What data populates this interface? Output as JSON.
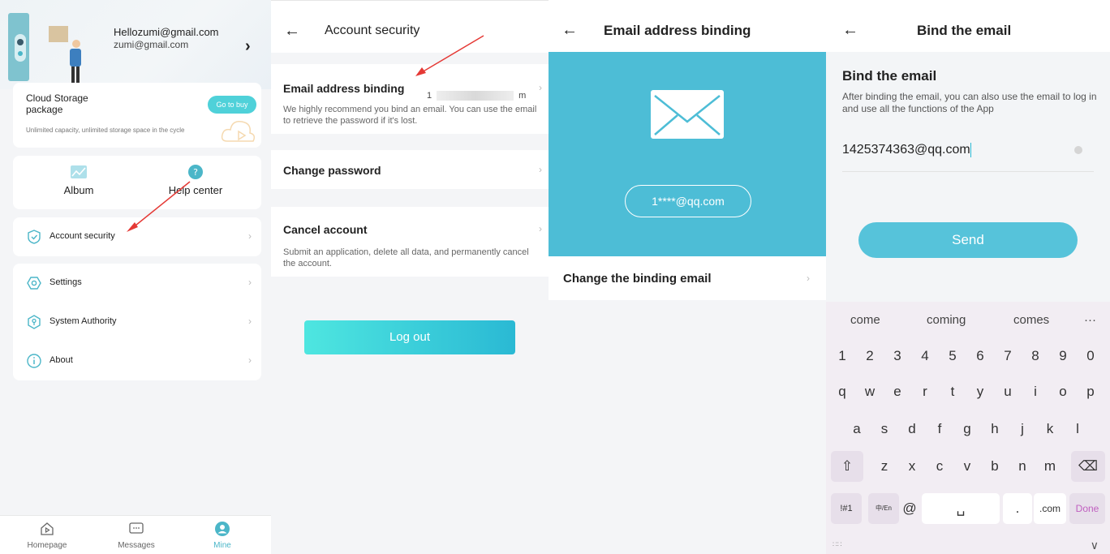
{
  "panel1": {
    "user_email": "Hellozumi@gmail.com",
    "user_email_sub": "zumi@gmail.com",
    "cloud": {
      "title": "Cloud Storage package",
      "desc": "Unlimited capacity, unlimited storage space in the cycle",
      "button": "Go to buy"
    },
    "quick": [
      {
        "label": "Album",
        "icon": "album-icon"
      },
      {
        "label": "Help center",
        "icon": "help-icon"
      }
    ],
    "menu": [
      {
        "label": "Account security",
        "icon": "shield-icon"
      },
      {
        "label": "Settings",
        "icon": "settings-icon"
      },
      {
        "label": "System Authority",
        "icon": "authority-icon"
      },
      {
        "label": "About",
        "icon": "info-icon"
      }
    ],
    "tabs": [
      {
        "label": "Homepage"
      },
      {
        "label": "Messages"
      },
      {
        "label": "Mine"
      }
    ],
    "accent": "#4bb6c8"
  },
  "panel2": {
    "title": "Account security",
    "email_binding": {
      "title": "Email address binding",
      "value_start": "1",
      "value_end": "m",
      "desc": "We highly recommend you bind an email. You can use the email to retrieve the password if it's lost."
    },
    "change_password": {
      "title": "Change password"
    },
    "cancel_account": {
      "title": "Cancel account",
      "desc": "Submit an application, delete all data, and permanently cancel the account."
    },
    "logout": "Log out"
  },
  "panel3": {
    "title": "Email address binding",
    "masked_email": "1****@qq.com",
    "change_label": "Change the binding email",
    "blue": "#4dbdd6"
  },
  "panel4": {
    "title": "Bind the email",
    "heading": "Bind the email",
    "desc": "After binding the email, you can also use the email to log in and use all the functions of the App",
    "email_value": "1425374363@qq.com",
    "send": "Send",
    "keyboard": {
      "suggestions": [
        "come",
        "coming",
        "comes",
        "···"
      ],
      "row_numbers": [
        "1",
        "2",
        "3",
        "4",
        "5",
        "6",
        "7",
        "8",
        "9",
        "0"
      ],
      "row_top": [
        "q",
        "w",
        "e",
        "r",
        "t",
        "y",
        "u",
        "i",
        "o",
        "p"
      ],
      "row_mid": [
        "a",
        "s",
        "d",
        "f",
        "g",
        "h",
        "j",
        "k",
        "l"
      ],
      "row_bottom": [
        "z",
        "x",
        "c",
        "v",
        "b",
        "n",
        "m"
      ],
      "shift": "⇧",
      "backspace": "⌫",
      "sym": "!#1",
      "lang": "中/En",
      "at": "@",
      "period": ".",
      "dotcom": ".com",
      "done": "Done"
    }
  }
}
